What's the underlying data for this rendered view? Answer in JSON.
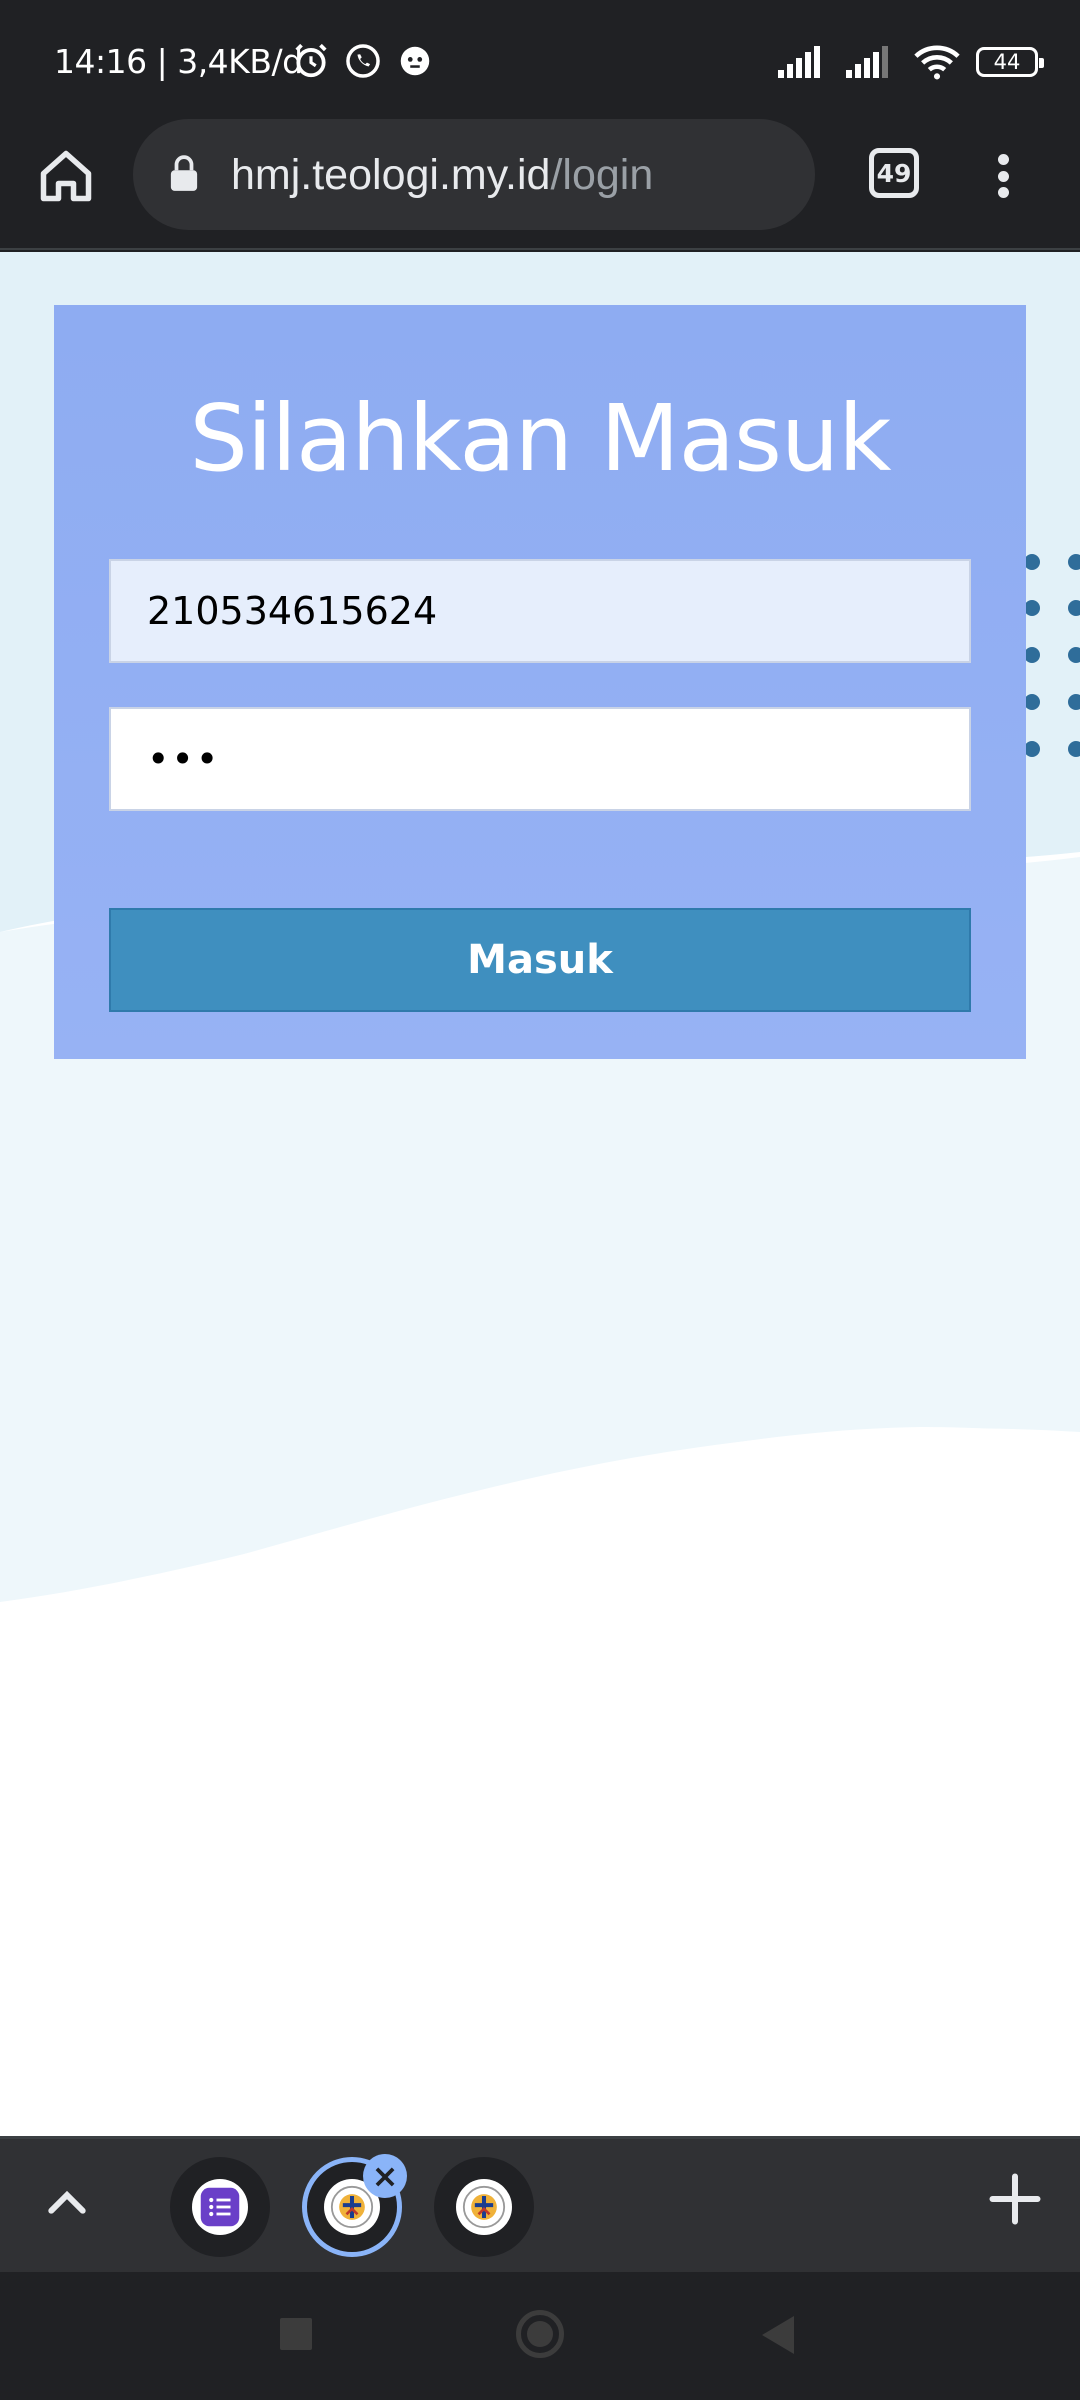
{
  "status_bar": {
    "time": "14:16 | 3,4KB/d",
    "battery_level": "44",
    "icons": [
      "alarm-icon",
      "whatsapp-icon",
      "app-notification-icon",
      "signal-icon",
      "signal-icon",
      "wifi-icon",
      "battery-icon"
    ]
  },
  "browser": {
    "url_domain": "hmj.teologi.my.id",
    "url_path": "/login",
    "tab_count": "49"
  },
  "login": {
    "title": "Silahkan Masuk",
    "username_value": "210534615624",
    "password_value": "•••",
    "submit_label": "Masuk"
  },
  "colors": {
    "card": "#8eacf2",
    "button": "#3f8fbf",
    "background_wave": "#e2f1f8",
    "dots": "#2f6d9a"
  },
  "tab_strip": {
    "tabs": [
      {
        "name": "tasks-app-tab",
        "active": false
      },
      {
        "name": "hmj-logo-tab",
        "active": true
      },
      {
        "name": "hmj-logo-tab-2",
        "active": false
      }
    ]
  }
}
